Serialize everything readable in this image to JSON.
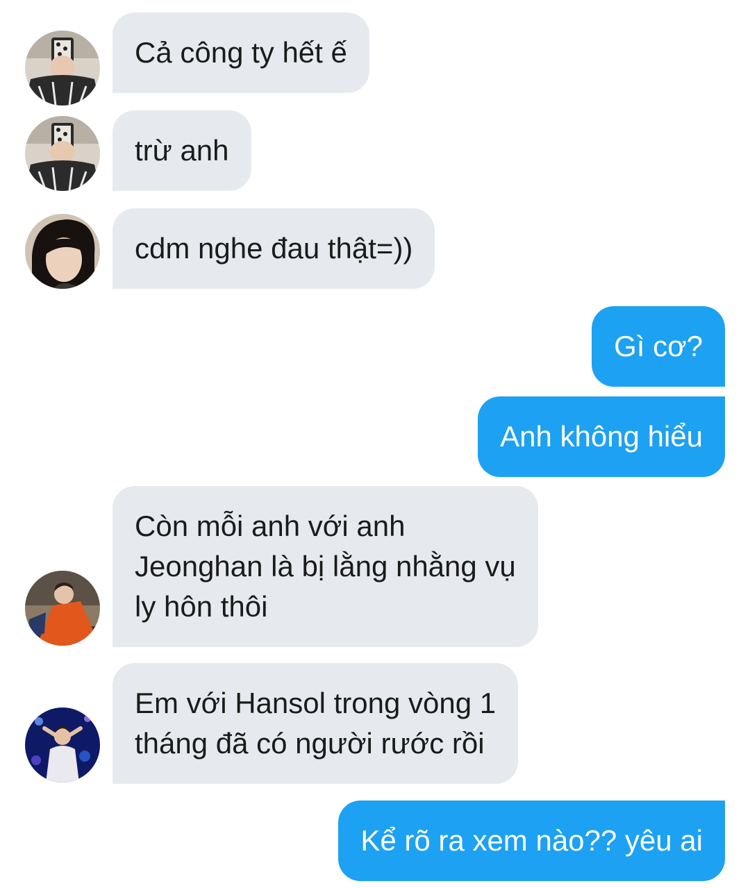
{
  "colors": {
    "incoming_bubble": "#e6eaee",
    "outgoing_bubble": "#1da1f2",
    "outgoing_text": "#ffffff",
    "incoming_text": "#1b1b1b"
  },
  "messages": [
    {
      "direction": "incoming",
      "avatar": "avatar-mirror-selfie",
      "text": "Cả công ty hết ế"
    },
    {
      "direction": "incoming",
      "avatar": "avatar-mirror-selfie",
      "text": "trừ anh"
    },
    {
      "direction": "incoming",
      "avatar": "avatar-dark-hair",
      "text": "cdm nghe đau thật=))"
    },
    {
      "direction": "outgoing",
      "text": "Gì cơ?"
    },
    {
      "direction": "outgoing",
      "text": "Anh không hiểu"
    },
    {
      "direction": "incoming",
      "avatar": "avatar-orange-shirt",
      "text": "Còn mỗi anh với anh\nJeonghan là bị lằng nhằng vụ\nly hôn thôi"
    },
    {
      "direction": "incoming",
      "avatar": "avatar-stage-concert",
      "text": "Em với Hansol trong vòng 1\ntháng đã có người rước rồi"
    },
    {
      "direction": "outgoing",
      "text": "Kể rõ ra xem nào?? yêu ai"
    }
  ]
}
